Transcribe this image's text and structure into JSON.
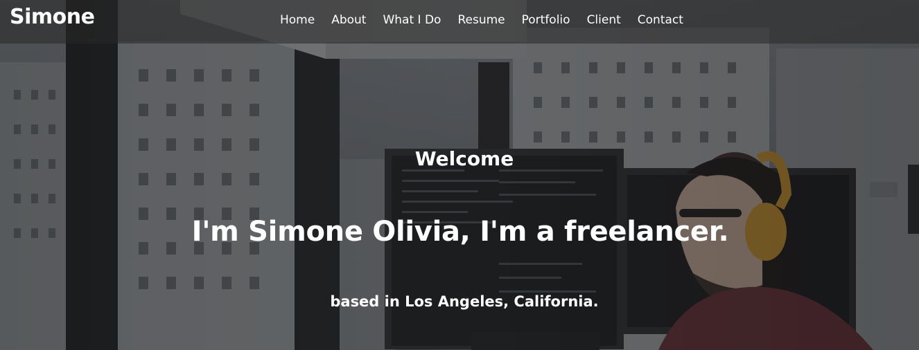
{
  "brand": "Simone",
  "nav": {
    "items": [
      {
        "label": "Home"
      },
      {
        "label": "About"
      },
      {
        "label": "What I Do"
      },
      {
        "label": "Resume"
      },
      {
        "label": "Portfolio"
      },
      {
        "label": "Client"
      },
      {
        "label": "Contact"
      }
    ]
  },
  "hero": {
    "welcome": "Welcome",
    "headline": "I'm Simone Olivia, I'm a freelancer.",
    "location": "based in Los Angeles, California."
  },
  "colors": {
    "text": "#ffffff",
    "headphones": "#d49a2a",
    "navbar_bg": "#3a3a3a"
  }
}
